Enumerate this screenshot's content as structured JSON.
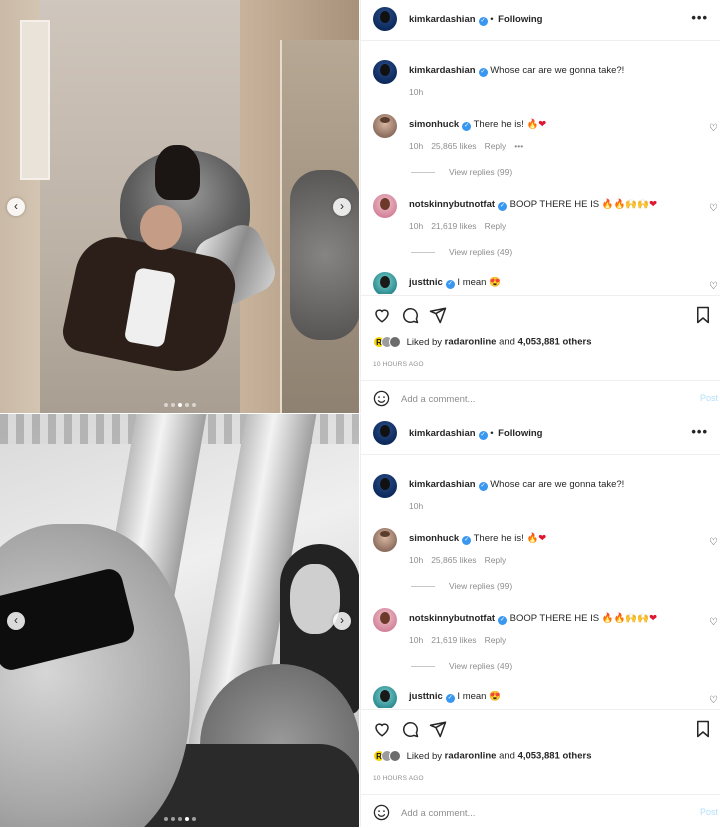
{
  "posts": [
    {
      "author": "kimkardashian",
      "following_label": "Following",
      "more_label": "•••",
      "caption": {
        "username": "kimkardashian",
        "text": "Whose car are we gonna take?!",
        "time": "10h"
      },
      "comments": [
        {
          "username": "simonhuck",
          "text": "There he is!",
          "emoji": [
            "fire",
            "heart"
          ],
          "time": "10h",
          "likes": "25,865 likes",
          "reply_label": "Reply",
          "more": "•••",
          "view_replies": "View replies (99)"
        },
        {
          "username": "notskinnybutnotfat",
          "text": "BOOP THERE HE IS",
          "emoji": [
            "fire",
            "fire",
            "raised-hands",
            "raised-hands",
            "heart"
          ],
          "time": "10h",
          "likes": "21,619 likes",
          "reply_label": "Reply",
          "view_replies": "View replies (49)"
        },
        {
          "username": "justtnic",
          "text": "I mean",
          "emoji": [
            "heart-eyes"
          ]
        }
      ],
      "liked_by_prefix": "Liked by",
      "liked_by_user": "radaronline",
      "liked_by_suffix": "and",
      "liked_by_count": "4,053,881 others",
      "time_ago": "10 HOURS AGO",
      "comment_placeholder": "Add a comment...",
      "post_label": "Post",
      "carousel": {
        "count": 5,
        "active_index": 2
      }
    },
    {
      "author": "kimkardashian",
      "following_label": "Following",
      "more_label": "•••",
      "caption": {
        "username": "kimkardashian",
        "text": "Whose car are we gonna take?!",
        "time": "10h"
      },
      "comments": [
        {
          "username": "simonhuck",
          "text": "There he is!",
          "emoji": [
            "fire",
            "heart"
          ],
          "time": "10h",
          "likes": "25,865 likes",
          "reply_label": "Reply",
          "view_replies": "View replies (99)"
        },
        {
          "username": "notskinnybutnotfat",
          "text": "BOOP THERE HE IS",
          "emoji": [
            "fire",
            "fire",
            "raised-hands",
            "raised-hands",
            "heart"
          ],
          "time": "10h",
          "likes": "21,619 likes",
          "reply_label": "Reply",
          "view_replies": "View replies (49)"
        },
        {
          "username": "justtnic",
          "text": "I mean",
          "emoji": [
            "heart-eyes"
          ]
        }
      ],
      "liked_by_prefix": "Liked by",
      "liked_by_user": "radaronline",
      "liked_by_suffix": "and",
      "liked_by_count": "4,053,881 others",
      "time_ago": "10 HOURS AGO",
      "comment_placeholder": "Add a comment...",
      "post_label": "Post",
      "carousel": {
        "count": 5,
        "active_index": 3
      }
    }
  ],
  "emoji_glyphs": {
    "fire": "🔥",
    "heart": "❤",
    "raised-hands": "🙌",
    "heart-eyes": "😍",
    "verified": "✓",
    "chevron-left": "‹",
    "chevron-right": "›",
    "smiley": "☺"
  },
  "colors": {
    "verified_blue": "#3897f0",
    "muted_text": "#8e8e8e",
    "post_button": "#b2dffc",
    "heart_red": "#e0152f"
  }
}
